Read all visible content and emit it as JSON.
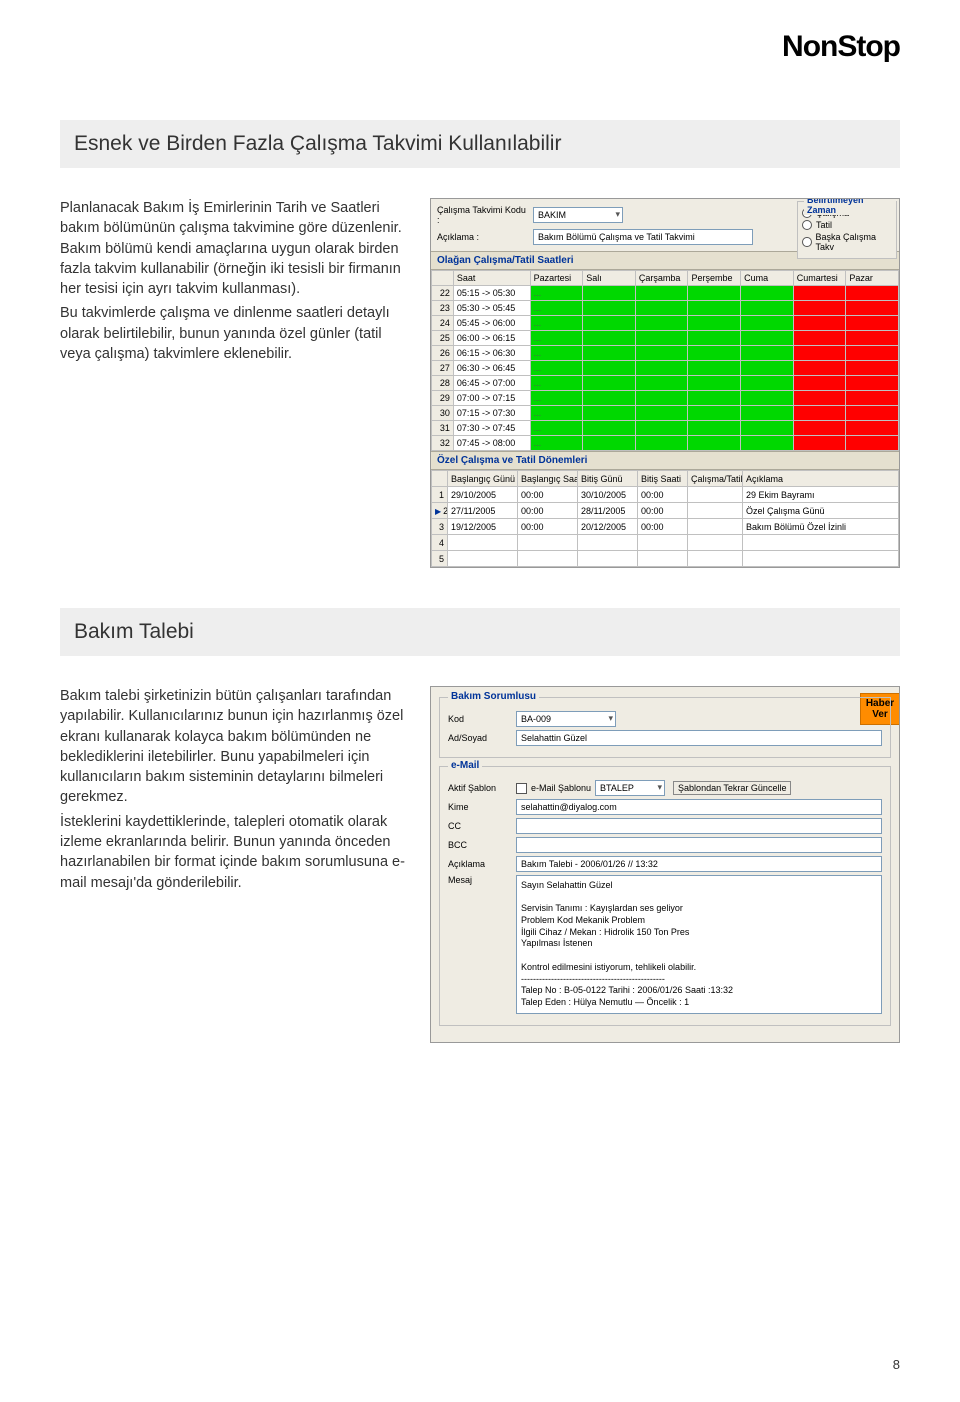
{
  "brand": "NonStop",
  "section1": {
    "heading": "Esnek ve Birden Fazla Çalışma Takvimi Kullanılabilir",
    "p1": "Planlanacak Bakım İş Emirlerinin Tarih ve Saatleri bakım bölümünün çalışma takvimine göre düzenlenir. Bakım bölümü kendi amaçlarına uygun olarak birden fazla takvim kullanabilir (örneğin iki tesisli bir firmanın her tesisi için ayrı takvim kullanması).",
    "p2": "Bu takvimlerde çalışma ve dinlenme saatleri detaylı olarak belirtilebilir, bunun yanında özel günler (tatil veya çalışma) takvimlere eklenebilir."
  },
  "schedule": {
    "code_label": "Çalışma Takvimi Kodu :",
    "code_value": "BAKIM",
    "desc_label": "Açıklama :",
    "desc_value": "Bakım Bölümü Çalışma ve Tatil Takvimi",
    "radio_legend": "Belirtilmeyen Zaman",
    "radios": [
      {
        "label": "Çalışma",
        "checked": true
      },
      {
        "label": "Tatil",
        "checked": false
      },
      {
        "label": "Başka Çalışma Takv",
        "checked": false
      }
    ],
    "grid_label": "Olağan Çalışma/Tatil Saatleri",
    "days": [
      "Saat",
      "Pazartesi",
      "Salı",
      "Çarşamba",
      "Perşembe",
      "Cuma",
      "Cumartesi",
      "Pazar"
    ],
    "rows": [
      {
        "n": 22,
        "t": "05:15 -> 05:30"
      },
      {
        "n": 23,
        "t": "05:30 -> 05:45"
      },
      {
        "n": 24,
        "t": "05:45 -> 06:00"
      },
      {
        "n": 25,
        "t": "06:00 -> 06:15"
      },
      {
        "n": 26,
        "t": "06:15 -> 06:30"
      },
      {
        "n": 27,
        "t": "06:30 -> 06:45"
      },
      {
        "n": 28,
        "t": "06:45 -> 07:00"
      },
      {
        "n": 29,
        "t": "07:00 -> 07:15"
      },
      {
        "n": 30,
        "t": "07:15 -> 07:30"
      },
      {
        "n": 31,
        "t": "07:30 -> 07:45"
      },
      {
        "n": 32,
        "t": "07:45 -> 08:00"
      }
    ],
    "special_label": "Özel Çalışma ve Tatil Dönemleri",
    "special_headers": [
      "Başlangıç Günü",
      "Başlangıç Saati",
      "Bitiş Günü",
      "Bitiş Saati",
      "Çalışma/Tatil",
      "Açıklama"
    ],
    "special": [
      {
        "n": 1,
        "bg": "29/10/2005",
        "bs": "00:00",
        "eg": "30/10/2005",
        "es": "00:00",
        "ct": "r",
        "desc": "29 Ekim Bayramı"
      },
      {
        "n": 2,
        "bg": "27/11/2005",
        "bs": "00:00",
        "eg": "28/11/2005",
        "es": "00:00",
        "ct": "g",
        "desc": "Özel Çalışma Günü",
        "active": true
      },
      {
        "n": 3,
        "bg": "19/12/2005",
        "bs": "00:00",
        "eg": "20/12/2005",
        "es": "00:00",
        "ct": "r",
        "desc": "Bakım Bölümü Özel İzinli"
      }
    ]
  },
  "section2": {
    "heading": "Bakım Talebi",
    "p1": "Bakım talebi şirketinizin bütün çalışanları tarafından yapılabilir. Kullanıcılarınız bunun için hazırlanmış özel ekranı kullanarak kolayca bakım bölümünden ne beklediklerini iletebilirler. Bunu yapabilmeleri için kullanıcıların bakım sisteminin detaylarını bilmeleri gerekmez.",
    "p2": "İsteklerini kaydettiklerinde, talepleri otomatik olarak izleme ekranlarında belirir. Bunun yanında önceden hazırlanabilen bir format içinde bakım sorumlusuna e-mail mesajı'da gönderilebilir."
  },
  "request": {
    "orange_btn": "Haber\nVer",
    "sorumlu_legend": "Bakım Sorumlusu",
    "kod_label": "Kod",
    "kod_value": "BA-009",
    "adsoyad_label": "Ad/Soyad",
    "adsoyad_value": "Selahattin Güzel",
    "email_legend": "e-Mail",
    "aktif_label": "Aktif Şablon",
    "sablon_label": "e-Mail Şablonu",
    "sablon_value": "BTALEP",
    "sablon_btn": "Şablondan Tekrar Güncelle",
    "kime_label": "Kime",
    "kime_value": "selahattin@diyalog.com",
    "cc_label": "CC",
    "bcc_label": "BCC",
    "aciklama_label": "Açıklama",
    "aciklama_value": "Bakım Talebi - 2006/01/26 // 13:32",
    "mesaj_label": "Mesaj",
    "mesaj_value": "Sayın Selahattin Güzel\n\nServisin  Tanımı  : Kayışlardan ses geliyor\nProblem  Kod        Mekanik Problem\nİlgili Cihaz / Mekan  : Hidrolik 150 Ton Pres\nYapılması İstenen\n\nKontrol edilmesini istiyorum, tehlikeli olabilir.\n------------------------------------------------\nTalep  No    : B-05-0122  Tarihi  : 2006/01/26 Saati  :13:32\nTalep Eden : Hülya Nemutlu — Öncelik : 1"
  },
  "page_num": "8"
}
